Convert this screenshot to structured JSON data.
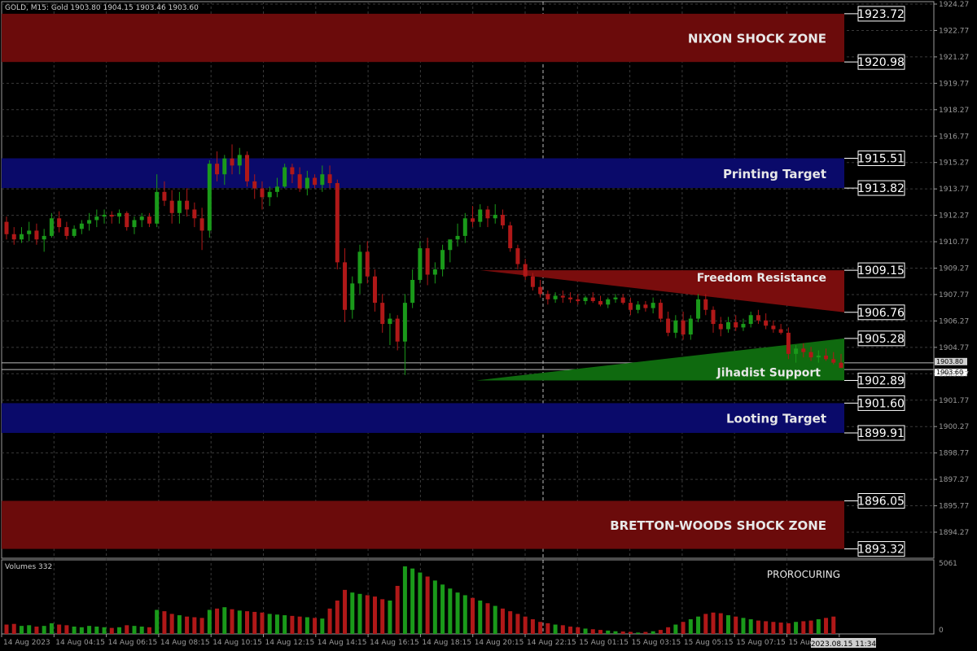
{
  "chart": {
    "header": "GOLD, M15:  Gold  1903.80 1904.15 1903.46 1903.60",
    "volume_label": "Volumes 332",
    "indicator_label": "PROROCURING",
    "y_ticks": [
      "1924.27",
      "1922.77",
      "1921.27",
      "1919.77",
      "1918.27",
      "1916.77",
      "1915.27",
      "1913.77",
      "1912.27",
      "1910.77",
      "1909.27",
      "1907.77",
      "1906.27",
      "1904.77",
      "1903.27",
      "1901.77",
      "1900.27",
      "1898.77",
      "1897.27",
      "1895.77",
      "1894.27"
    ],
    "volume_ticks": [
      "5061",
      "0"
    ],
    "bid_tag": "1903.80",
    "price_tag": "1903.60",
    "cursor_time": "2023.08.15 11:34",
    "x_labels": [
      "14 Aug 2023",
      "14 Aug 04:15",
      "14 Aug 06:15",
      "14 Aug 08:15",
      "14 Aug 10:15",
      "14 Aug 12:15",
      "14 Aug 14:15",
      "14 Aug 16:15",
      "14 Aug 18:15",
      "14 Aug 20:15",
      "14 Aug 22:15",
      "15 Aug 01:15",
      "15 Aug 03:15",
      "15 Aug 05:15",
      "15 Aug 07:15",
      "15 Aug 09:15",
      "5"
    ],
    "zones": [
      {
        "label": "NIXON SHOCK ZONE",
        "top_price": "1923.72",
        "bottom_price": "1920.98",
        "hi": 1923.72,
        "lo": 1920.98,
        "fill": "#6b0b0b"
      },
      {
        "label": "Printing Target",
        "top_price": "1915.51",
        "bottom_price": "1913.82",
        "hi": 1915.51,
        "lo": 1913.82,
        "fill": "#0a0a6a"
      },
      {
        "label": "Looting Target",
        "top_price": "1901.60",
        "bottom_price": "1899.91",
        "hi": 1901.6,
        "lo": 1899.91,
        "fill": "#0a0a6a"
      },
      {
        "label": "BRETTON-WOODS SHOCK ZONE",
        "top_price": "1896.05",
        "bottom_price": "1893.32",
        "hi": 1896.05,
        "lo": 1893.32,
        "fill": "#6b0b0b"
      }
    ],
    "triangles": [
      {
        "label": "Freedom Resistance",
        "top_price": "1909.15",
        "bottom_price": "1906.76",
        "fill": "#7a0d0d"
      },
      {
        "label": "Jihadist Support",
        "top_price": "1905.28",
        "bottom_price": "1902.89",
        "fill": "#0f6a0f"
      }
    ],
    "colors": {
      "up": "#1a9a1a",
      "down": "#b01818",
      "grid": "#3a3a3a",
      "axis": "#9a9a9a",
      "label": "#e8e8e8"
    }
  },
  "chart_data": {
    "type": "candlestick",
    "series": [
      {
        "name": "GOLD, M15",
        "ohlc": [
          [
            1911.9,
            1912.2,
            1910.9,
            1911.2
          ],
          [
            1911.2,
            1911.6,
            1910.6,
            1910.9
          ],
          [
            1910.9,
            1911.6,
            1910.7,
            1911.2
          ],
          [
            1911.2,
            1911.9,
            1910.8,
            1911.4
          ],
          [
            1911.4,
            1911.8,
            1910.6,
            1910.9
          ],
          [
            1910.9,
            1911.5,
            1910.2,
            1911.1
          ],
          [
            1911.1,
            1912.4,
            1911.0,
            1912.1
          ],
          [
            1912.1,
            1912.5,
            1911.3,
            1911.6
          ],
          [
            1911.6,
            1911.9,
            1910.9,
            1911.1
          ],
          [
            1911.1,
            1911.7,
            1911.0,
            1911.5
          ],
          [
            1911.5,
            1912.0,
            1911.2,
            1911.8
          ],
          [
            1911.8,
            1912.4,
            1911.4,
            1912.0
          ],
          [
            1912.0,
            1912.6,
            1911.6,
            1912.2
          ],
          [
            1912.2,
            1912.6,
            1911.8,
            1912.3
          ],
          [
            1912.3,
            1912.5,
            1911.8,
            1912.2
          ],
          [
            1912.2,
            1912.6,
            1911.8,
            1912.4
          ],
          [
            1912.4,
            1912.5,
            1911.4,
            1911.6
          ],
          [
            1911.6,
            1912.2,
            1911.2,
            1912.0
          ],
          [
            1912.0,
            1912.4,
            1911.6,
            1912.2
          ],
          [
            1912.2,
            1912.4,
            1911.6,
            1911.8
          ],
          [
            1911.8,
            1914.6,
            1911.6,
            1913.6
          ],
          [
            1913.6,
            1914.2,
            1912.8,
            1913.1
          ],
          [
            1913.1,
            1913.7,
            1911.8,
            1912.4
          ],
          [
            1912.4,
            1913.6,
            1911.8,
            1913.1
          ],
          [
            1913.1,
            1913.8,
            1912.2,
            1912.6
          ],
          [
            1912.6,
            1913.0,
            1911.6,
            1912.1
          ],
          [
            1912.1,
            1912.7,
            1910.3,
            1911.4
          ],
          [
            1911.4,
            1915.4,
            1911.0,
            1915.2
          ],
          [
            1915.2,
            1915.9,
            1914.2,
            1914.6
          ],
          [
            1914.6,
            1915.7,
            1914.0,
            1915.5
          ],
          [
            1915.5,
            1916.3,
            1914.6,
            1915.1
          ],
          [
            1915.1,
            1916.1,
            1914.6,
            1915.7
          ],
          [
            1915.7,
            1915.9,
            1913.9,
            1914.2
          ],
          [
            1914.2,
            1914.6,
            1913.2,
            1913.8
          ],
          [
            1913.8,
            1914.2,
            1912.6,
            1913.3
          ],
          [
            1913.3,
            1913.9,
            1912.8,
            1913.6
          ],
          [
            1913.6,
            1914.4,
            1913.3,
            1913.9
          ],
          [
            1913.9,
            1915.2,
            1913.8,
            1915.0
          ],
          [
            1915.0,
            1915.2,
            1914.1,
            1914.6
          ],
          [
            1914.6,
            1915.0,
            1913.6,
            1913.8
          ],
          [
            1913.8,
            1914.8,
            1913.4,
            1914.4
          ],
          [
            1914.4,
            1914.6,
            1913.8,
            1914.0
          ],
          [
            1914.0,
            1915.1,
            1913.6,
            1914.6
          ],
          [
            1914.6,
            1915.1,
            1913.8,
            1914.1
          ],
          [
            1914.1,
            1914.3,
            1909.2,
            1909.6
          ],
          [
            1909.6,
            1910.4,
            1906.2,
            1906.9
          ],
          [
            1906.9,
            1908.8,
            1906.4,
            1908.4
          ],
          [
            1908.4,
            1910.6,
            1907.8,
            1910.2
          ],
          [
            1910.2,
            1910.8,
            1908.4,
            1908.8
          ],
          [
            1908.8,
            1909.2,
            1906.8,
            1907.3
          ],
          [
            1907.3,
            1907.8,
            1905.6,
            1906.1
          ],
          [
            1906.1,
            1906.7,
            1904.9,
            1906.4
          ],
          [
            1906.4,
            1906.6,
            1904.6,
            1905.1
          ],
          [
            1905.1,
            1907.8,
            1903.2,
            1907.3
          ],
          [
            1907.3,
            1909.2,
            1907.0,
            1908.6
          ],
          [
            1908.6,
            1910.8,
            1908.4,
            1910.4
          ],
          [
            1910.4,
            1911.0,
            1908.3,
            1908.9
          ],
          [
            1908.9,
            1909.6,
            1908.4,
            1909.2
          ],
          [
            1909.2,
            1910.6,
            1908.8,
            1910.3
          ],
          [
            1910.3,
            1910.6,
            1909.6,
            1910.9
          ],
          [
            1910.9,
            1911.8,
            1910.5,
            1911.1
          ],
          [
            1911.1,
            1912.4,
            1910.7,
            1912.1
          ],
          [
            1912.1,
            1912.8,
            1911.6,
            1911.9
          ],
          [
            1911.9,
            1912.9,
            1911.6,
            1912.6
          ],
          [
            1912.6,
            1912.8,
            1911.6,
            1912.1
          ],
          [
            1912.1,
            1912.9,
            1911.8,
            1912.3
          ],
          [
            1912.3,
            1912.6,
            1911.5,
            1911.7
          ],
          [
            1911.7,
            1911.9,
            1910.2,
            1910.4
          ],
          [
            1910.4,
            1910.6,
            1909.2,
            1909.5
          ],
          [
            1909.5,
            1909.8,
            1908.6,
            1908.8
          ],
          [
            1908.8,
            1909.0,
            1908.0,
            1908.2
          ],
          [
            1908.2,
            1908.6,
            1907.6,
            1907.8
          ],
          [
            1907.8,
            1908.0,
            1907.2,
            1907.5
          ],
          [
            1907.5,
            1907.9,
            1907.3,
            1907.7
          ],
          [
            1907.7,
            1908.0,
            1907.3,
            1907.6
          ],
          [
            1907.6,
            1907.9,
            1907.3,
            1907.5
          ],
          [
            1907.5,
            1907.8,
            1907.2,
            1907.4
          ],
          [
            1907.4,
            1907.7,
            1907.2,
            1907.6
          ],
          [
            1907.6,
            1907.9,
            1907.3,
            1907.4
          ],
          [
            1907.4,
            1907.7,
            1907.1,
            1907.2
          ],
          [
            1907.2,
            1907.6,
            1907.0,
            1907.5
          ],
          [
            1907.5,
            1907.8,
            1907.3,
            1907.6
          ],
          [
            1907.6,
            1907.8,
            1907.2,
            1907.3
          ],
          [
            1907.3,
            1907.6,
            1906.6,
            1906.9
          ],
          [
            1906.9,
            1907.4,
            1906.7,
            1907.2
          ],
          [
            1907.2,
            1907.4,
            1906.8,
            1907.0
          ],
          [
            1907.0,
            1907.6,
            1906.7,
            1907.3
          ],
          [
            1907.3,
            1907.5,
            1906.2,
            1906.4
          ],
          [
            1906.4,
            1906.8,
            1905.4,
            1905.6
          ],
          [
            1905.6,
            1906.6,
            1905.3,
            1906.3
          ],
          [
            1906.3,
            1906.8,
            1905.2,
            1905.5
          ],
          [
            1905.5,
            1906.6,
            1905.2,
            1906.4
          ],
          [
            1906.4,
            1907.8,
            1906.2,
            1907.5
          ],
          [
            1907.5,
            1907.8,
            1906.6,
            1906.9
          ],
          [
            1906.9,
            1907.1,
            1905.6,
            1906.1
          ],
          [
            1906.1,
            1906.5,
            1905.4,
            1905.8
          ],
          [
            1905.8,
            1906.5,
            1905.6,
            1906.2
          ],
          [
            1906.2,
            1906.6,
            1905.7,
            1905.9
          ],
          [
            1905.9,
            1906.4,
            1905.7,
            1906.1
          ],
          [
            1906.1,
            1906.8,
            1905.9,
            1906.6
          ],
          [
            1906.6,
            1906.9,
            1906.1,
            1906.3
          ],
          [
            1906.3,
            1906.7,
            1905.8,
            1906.0
          ],
          [
            1906.0,
            1906.3,
            1905.6,
            1905.8
          ],
          [
            1905.8,
            1906.1,
            1905.5,
            1905.6
          ],
          [
            1905.6,
            1905.9,
            1904.1,
            1904.4
          ],
          [
            1904.4,
            1904.9,
            1903.9,
            1904.7
          ],
          [
            1904.7,
            1905.0,
            1904.2,
            1904.5
          ],
          [
            1904.5,
            1904.8,
            1904.0,
            1904.2
          ],
          [
            1904.2,
            1904.6,
            1903.9,
            1904.3
          ],
          [
            1904.3,
            1904.7,
            1904.0,
            1904.1
          ],
          [
            1904.1,
            1904.5,
            1903.8,
            1903.9
          ],
          [
            1903.9,
            1904.4,
            1903.6,
            1903.6
          ]
        ]
      }
    ]
  },
  "volumes": [
    700,
    750,
    600,
    650,
    550,
    600,
    800,
    700,
    650,
    550,
    500,
    600,
    550,
    500,
    450,
    500,
    650,
    600,
    550,
    500,
    1800,
    1700,
    1500,
    1400,
    1300,
    1250,
    1200,
    1800,
    1900,
    2000,
    1850,
    1750,
    1700,
    1650,
    1600,
    1500,
    1450,
    1400,
    1350,
    1300,
    1250,
    1200,
    1150,
    1900,
    2500,
    3300,
    3100,
    3000,
    2900,
    2800,
    2600,
    2500,
    3600,
    5061,
    4900,
    4600,
    4300,
    4000,
    3700,
    3400,
    3100,
    2900,
    2700,
    2500,
    2300,
    2100,
    1900,
    1700,
    1500,
    1300,
    1100,
    900,
    800,
    700,
    650,
    550,
    500,
    400,
    350,
    300,
    250,
    200,
    180,
    150,
    100,
    150,
    200,
    300,
    500,
    700,
    900,
    1100,
    1300,
    1500,
    1600,
    1550,
    1400,
    1300,
    1200,
    1100,
    1000,
    950,
    900,
    850,
    800,
    900,
    950,
    1000,
    1100,
    1200,
    1300
  ]
}
